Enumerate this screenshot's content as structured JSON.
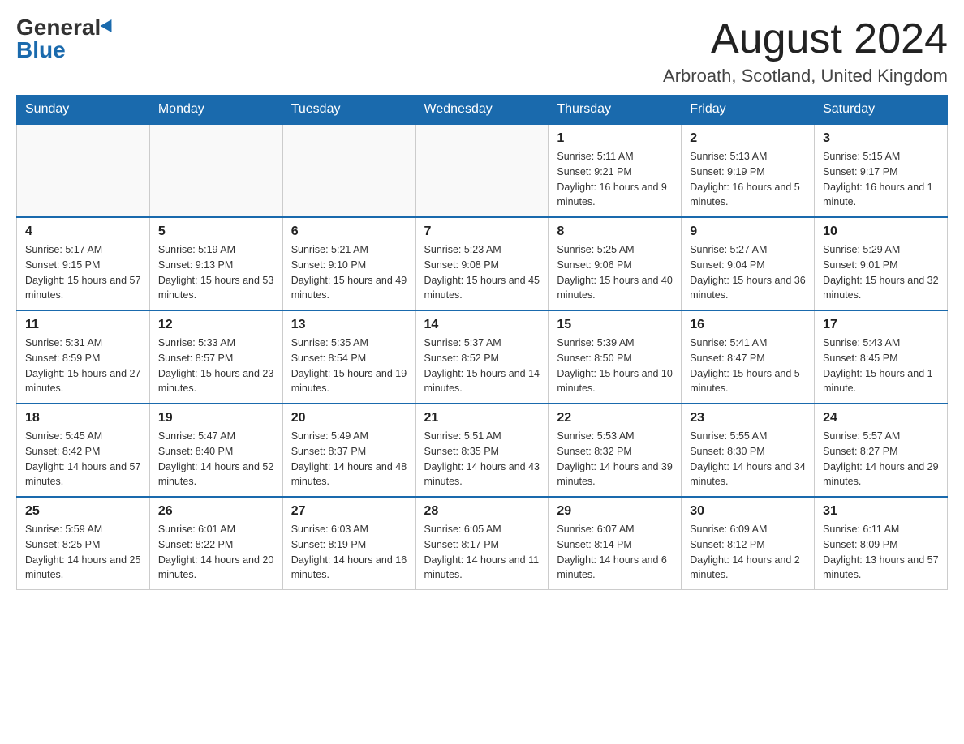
{
  "logo": {
    "general": "General",
    "blue": "Blue"
  },
  "header": {
    "month_year": "August 2024",
    "location": "Arbroath, Scotland, United Kingdom"
  },
  "weekdays": [
    "Sunday",
    "Monday",
    "Tuesday",
    "Wednesday",
    "Thursday",
    "Friday",
    "Saturday"
  ],
  "weeks": [
    [
      {
        "day": "",
        "info": ""
      },
      {
        "day": "",
        "info": ""
      },
      {
        "day": "",
        "info": ""
      },
      {
        "day": "",
        "info": ""
      },
      {
        "day": "1",
        "info": "Sunrise: 5:11 AM\nSunset: 9:21 PM\nDaylight: 16 hours and 9 minutes."
      },
      {
        "day": "2",
        "info": "Sunrise: 5:13 AM\nSunset: 9:19 PM\nDaylight: 16 hours and 5 minutes."
      },
      {
        "day": "3",
        "info": "Sunrise: 5:15 AM\nSunset: 9:17 PM\nDaylight: 16 hours and 1 minute."
      }
    ],
    [
      {
        "day": "4",
        "info": "Sunrise: 5:17 AM\nSunset: 9:15 PM\nDaylight: 15 hours and 57 minutes."
      },
      {
        "day": "5",
        "info": "Sunrise: 5:19 AM\nSunset: 9:13 PM\nDaylight: 15 hours and 53 minutes."
      },
      {
        "day": "6",
        "info": "Sunrise: 5:21 AM\nSunset: 9:10 PM\nDaylight: 15 hours and 49 minutes."
      },
      {
        "day": "7",
        "info": "Sunrise: 5:23 AM\nSunset: 9:08 PM\nDaylight: 15 hours and 45 minutes."
      },
      {
        "day": "8",
        "info": "Sunrise: 5:25 AM\nSunset: 9:06 PM\nDaylight: 15 hours and 40 minutes."
      },
      {
        "day": "9",
        "info": "Sunrise: 5:27 AM\nSunset: 9:04 PM\nDaylight: 15 hours and 36 minutes."
      },
      {
        "day": "10",
        "info": "Sunrise: 5:29 AM\nSunset: 9:01 PM\nDaylight: 15 hours and 32 minutes."
      }
    ],
    [
      {
        "day": "11",
        "info": "Sunrise: 5:31 AM\nSunset: 8:59 PM\nDaylight: 15 hours and 27 minutes."
      },
      {
        "day": "12",
        "info": "Sunrise: 5:33 AM\nSunset: 8:57 PM\nDaylight: 15 hours and 23 minutes."
      },
      {
        "day": "13",
        "info": "Sunrise: 5:35 AM\nSunset: 8:54 PM\nDaylight: 15 hours and 19 minutes."
      },
      {
        "day": "14",
        "info": "Sunrise: 5:37 AM\nSunset: 8:52 PM\nDaylight: 15 hours and 14 minutes."
      },
      {
        "day": "15",
        "info": "Sunrise: 5:39 AM\nSunset: 8:50 PM\nDaylight: 15 hours and 10 minutes."
      },
      {
        "day": "16",
        "info": "Sunrise: 5:41 AM\nSunset: 8:47 PM\nDaylight: 15 hours and 5 minutes."
      },
      {
        "day": "17",
        "info": "Sunrise: 5:43 AM\nSunset: 8:45 PM\nDaylight: 15 hours and 1 minute."
      }
    ],
    [
      {
        "day": "18",
        "info": "Sunrise: 5:45 AM\nSunset: 8:42 PM\nDaylight: 14 hours and 57 minutes."
      },
      {
        "day": "19",
        "info": "Sunrise: 5:47 AM\nSunset: 8:40 PM\nDaylight: 14 hours and 52 minutes."
      },
      {
        "day": "20",
        "info": "Sunrise: 5:49 AM\nSunset: 8:37 PM\nDaylight: 14 hours and 48 minutes."
      },
      {
        "day": "21",
        "info": "Sunrise: 5:51 AM\nSunset: 8:35 PM\nDaylight: 14 hours and 43 minutes."
      },
      {
        "day": "22",
        "info": "Sunrise: 5:53 AM\nSunset: 8:32 PM\nDaylight: 14 hours and 39 minutes."
      },
      {
        "day": "23",
        "info": "Sunrise: 5:55 AM\nSunset: 8:30 PM\nDaylight: 14 hours and 34 minutes."
      },
      {
        "day": "24",
        "info": "Sunrise: 5:57 AM\nSunset: 8:27 PM\nDaylight: 14 hours and 29 minutes."
      }
    ],
    [
      {
        "day": "25",
        "info": "Sunrise: 5:59 AM\nSunset: 8:25 PM\nDaylight: 14 hours and 25 minutes."
      },
      {
        "day": "26",
        "info": "Sunrise: 6:01 AM\nSunset: 8:22 PM\nDaylight: 14 hours and 20 minutes."
      },
      {
        "day": "27",
        "info": "Sunrise: 6:03 AM\nSunset: 8:19 PM\nDaylight: 14 hours and 16 minutes."
      },
      {
        "day": "28",
        "info": "Sunrise: 6:05 AM\nSunset: 8:17 PM\nDaylight: 14 hours and 11 minutes."
      },
      {
        "day": "29",
        "info": "Sunrise: 6:07 AM\nSunset: 8:14 PM\nDaylight: 14 hours and 6 minutes."
      },
      {
        "day": "30",
        "info": "Sunrise: 6:09 AM\nSunset: 8:12 PM\nDaylight: 14 hours and 2 minutes."
      },
      {
        "day": "31",
        "info": "Sunrise: 6:11 AM\nSunset: 8:09 PM\nDaylight: 13 hours and 57 minutes."
      }
    ]
  ]
}
